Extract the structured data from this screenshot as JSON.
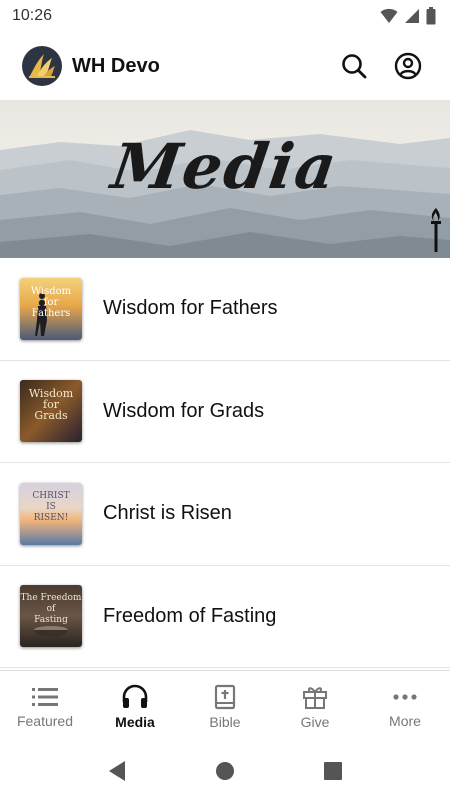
{
  "status_bar": {
    "time": "10:26",
    "icons": [
      "wifi-icon",
      "cell-signal-icon",
      "battery-icon"
    ]
  },
  "header": {
    "app_title": "WH Devo",
    "logo_icon": "flame-logo",
    "search_icon": "search-icon",
    "account_icon": "account-icon"
  },
  "banner": {
    "title": "Media",
    "icon": "torch-icon"
  },
  "media_items": [
    {
      "title": "Wisdom for Fathers",
      "thumb_text": [
        "Wisdom",
        "for",
        "Fathers"
      ]
    },
    {
      "title": "Wisdom for Grads",
      "thumb_text": [
        "Wisdom",
        "for",
        "Grads"
      ]
    },
    {
      "title": "Christ is Risen",
      "thumb_text": [
        "CHRIST",
        "IS",
        "RISEN!"
      ]
    },
    {
      "title": "Freedom of Fasting",
      "thumb_text": [
        "The Freedom",
        "of",
        "Fasting"
      ]
    }
  ],
  "bottom_nav": {
    "active": "Media",
    "items": [
      {
        "label": "Featured",
        "icon": "list-icon"
      },
      {
        "label": "Media",
        "icon": "headphones-icon"
      },
      {
        "label": "Bible",
        "icon": "bible-icon"
      },
      {
        "label": "Give",
        "icon": "gift-icon"
      },
      {
        "label": "More",
        "icon": "more-icon"
      }
    ]
  },
  "colors": {
    "active_nav": "#111111",
    "inactive_nav": "#777777",
    "logo_bg": "#2d3542",
    "logo_flame": "#e8b84a"
  }
}
